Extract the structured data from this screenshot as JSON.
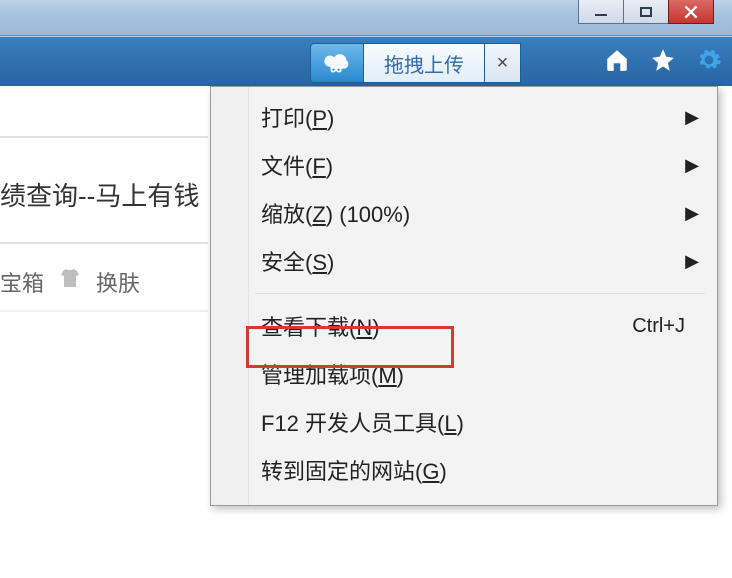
{
  "window": {
    "min": "minimize",
    "max": "maximize",
    "close": "close"
  },
  "tabbar": {
    "extension_icon": "cloud-infinity-icon",
    "tab_label": "拖拽上传",
    "close_label": "×",
    "home_icon": "home-icon",
    "star_icon": "star-icon",
    "gear_icon": "gear-icon"
  },
  "content": {
    "page_title_fragment": "绩查询--马上有钱",
    "toolbar_fragment_1": "宝箱",
    "toolbar_fragment_2": "换肤"
  },
  "menu": {
    "items": [
      {
        "label": "打印",
        "key": "P",
        "submenu": true
      },
      {
        "label": "文件",
        "key": "F",
        "submenu": true
      },
      {
        "label": "缩放",
        "key": "Z",
        "extra": " (100%)",
        "submenu": true
      },
      {
        "label": "安全",
        "key": "S",
        "submenu": true
      }
    ],
    "items2": [
      {
        "label": "查看下载",
        "key": "N",
        "shortcut": "Ctrl+J"
      },
      {
        "label": "管理加载项",
        "key": "M"
      },
      {
        "label": "F12 开发人员工具",
        "key": "L"
      },
      {
        "label": "转到固定的网站",
        "key": "G"
      }
    ]
  }
}
